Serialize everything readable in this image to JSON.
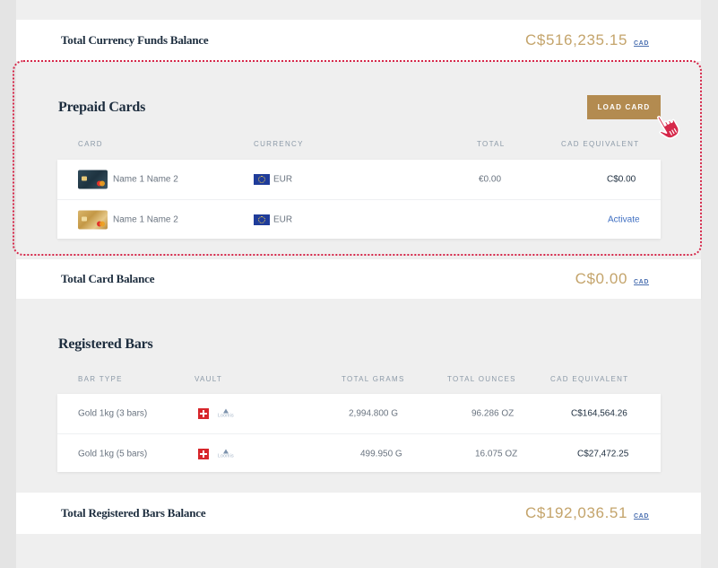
{
  "currency_funds": {
    "label": "Total Currency Funds Balance",
    "amount": "C$516,235.15",
    "currency": "CAD"
  },
  "prepaid": {
    "title": "Prepaid Cards",
    "load_button": "LOAD CARD",
    "columns": {
      "card": "CARD",
      "currency": "CURRENCY",
      "total": "TOTAL",
      "cad_equivalent": "CAD EQUIVALENT"
    },
    "rows": [
      {
        "card_icon": "dark-card-icon",
        "name": "Name 1 Name 2",
        "flag": "eu-flag-icon",
        "currency": "EUR",
        "total": "€0.00",
        "cad_equivalent": "C$0.00"
      },
      {
        "card_icon": "gold-card-icon",
        "name": "Name 1 Name 2",
        "flag": "eu-flag-icon",
        "currency": "EUR",
        "total": "",
        "action": "Activate"
      }
    ]
  },
  "card_balance": {
    "label": "Total Card Balance",
    "amount": "C$0.00",
    "currency": "CAD"
  },
  "bars": {
    "title": "Registered Bars",
    "columns": {
      "bar_type": "BAR TYPE",
      "vault": "VAULT",
      "total_grams": "TOTAL GRAMS",
      "total_ounces": "TOTAL OUNCES",
      "cad_equivalent": "CAD EQUIVALENT"
    },
    "rows": [
      {
        "bar_type": "Gold 1kg (3 bars)",
        "vault_flag": "swiss-flag-icon",
        "vault_logo": "Loomis",
        "total_grams": "2,994.800 G",
        "total_ounces": "96.286 OZ",
        "cad_equivalent": "C$164,564.26"
      },
      {
        "bar_type": "Gold 1kg (5 bars)",
        "vault_flag": "swiss-flag-icon",
        "vault_logo": "Loomis",
        "total_grams": "499.950 G",
        "total_ounces": "16.075 OZ",
        "cad_equivalent": "C$27,472.25"
      }
    ]
  },
  "bars_balance": {
    "label": "Total Registered Bars Balance",
    "amount": "C$192,036.51",
    "currency": "CAD"
  },
  "colors": {
    "accent_gold": "#c4a46b",
    "button_gold": "#b38b50",
    "link_blue": "#3f6fc2",
    "highlight_pink": "#d6284a"
  }
}
